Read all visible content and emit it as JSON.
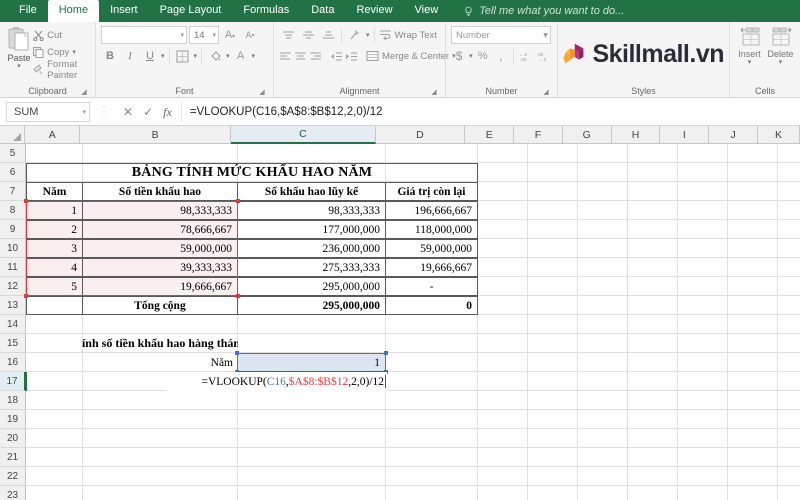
{
  "ribbon": {
    "tabs": [
      {
        "label": "File",
        "active": false
      },
      {
        "label": "Home",
        "active": true
      },
      {
        "label": "Insert",
        "active": false
      },
      {
        "label": "Page Layout",
        "active": false
      },
      {
        "label": "Formulas",
        "active": false
      },
      {
        "label": "Data",
        "active": false
      },
      {
        "label": "Review",
        "active": false
      },
      {
        "label": "View",
        "active": false
      }
    ],
    "tellme": "Tell me what you want to do...",
    "accent_color": "#217346",
    "clipboard": {
      "group_label": "Clipboard",
      "paste_label": "Paste",
      "cut_label": "Cut",
      "copy_label": "Copy",
      "format_painter_label": "Format Painter"
    },
    "font": {
      "group_label": "Font",
      "font_name": "",
      "font_size": "14",
      "bold_label": "B",
      "italic_label": "I",
      "underline_label": "U",
      "grow_label": "A",
      "shrink_label": "A",
      "fill_label": "A"
    },
    "alignment": {
      "group_label": "Alignment",
      "wrap_text_label": "Wrap Text",
      "merge_center_label": "Merge & Center"
    },
    "number": {
      "group_label": "Number",
      "format_value": "Number",
      "currency_label": "$",
      "percent_label": "%",
      "comma_label": ","
    },
    "styles": {
      "group_label": "Styles",
      "logo_text": "Skillmall.vn",
      "logo_color_magenta": "#a8246b",
      "logo_color_orange": "#f6921e"
    },
    "cells": {
      "group_label": "Cells",
      "insert_label": "Insert",
      "delete_label": "Delete"
    }
  },
  "formula_bar": {
    "name_box": "SUM",
    "cancel_icon": "cancel-icon",
    "enter_icon": "enter-icon",
    "fx_label": "fx",
    "formula": "=VLOOKUP(C16,$A$8:$B$12,2,0)/12"
  },
  "grid": {
    "columns": [
      "A",
      "B",
      "C",
      "D",
      "E",
      "F",
      "G",
      "H",
      "I",
      "J",
      "K"
    ],
    "selected_column": "C",
    "rows": [
      "5",
      "6",
      "7",
      "8",
      "9",
      "10",
      "11",
      "12",
      "13",
      "14",
      "15",
      "16",
      "17",
      "18",
      "19",
      "20",
      "21",
      "22",
      "23"
    ],
    "selected_row": "17",
    "title": "BẢNG TÍNH MỨC KHẤU HAO NĂM",
    "headers": [
      "Năm",
      "Số tiền khấu hao",
      "Số khấu hao lũy kế",
      "Giá trị còn lại"
    ],
    "data_rows": [
      {
        "nam": "1",
        "so_tien": "98,333,333",
        "luy_ke": "98,333,333",
        "con_lai": "196,666,667"
      },
      {
        "nam": "2",
        "so_tien": "78,666,667",
        "luy_ke": "177,000,000",
        "con_lai": "118,000,000"
      },
      {
        "nam": "3",
        "so_tien": "59,000,000",
        "luy_ke": "236,000,000",
        "con_lai": "59,000,000"
      },
      {
        "nam": "4",
        "so_tien": "39,333,333",
        "luy_ke": "275,333,333",
        "con_lai": "19,666,667"
      },
      {
        "nam": "5",
        "so_tien": "19,666,667",
        "luy_ke": "295,000,000",
        "con_lai": "-"
      }
    ],
    "total_row": {
      "label": "Tổng cộng",
      "luy_ke": "295,000,000",
      "con_lai": "0"
    },
    "section_label": "Tính số tiền khấu hao hàng tháng",
    "nam_label": "Năm",
    "nam_value": "1",
    "edit_formula": {
      "prefix": "=VLOOKUP(",
      "ref1": "C16",
      "comma1": ",",
      "ref2": "$A$8:$B$12",
      "suffix": ",2,0)/12"
    },
    "selection_color_red": "#e03b3b",
    "selection_color_blue": "#4472c4",
    "range_fill": "#fbeeee"
  }
}
